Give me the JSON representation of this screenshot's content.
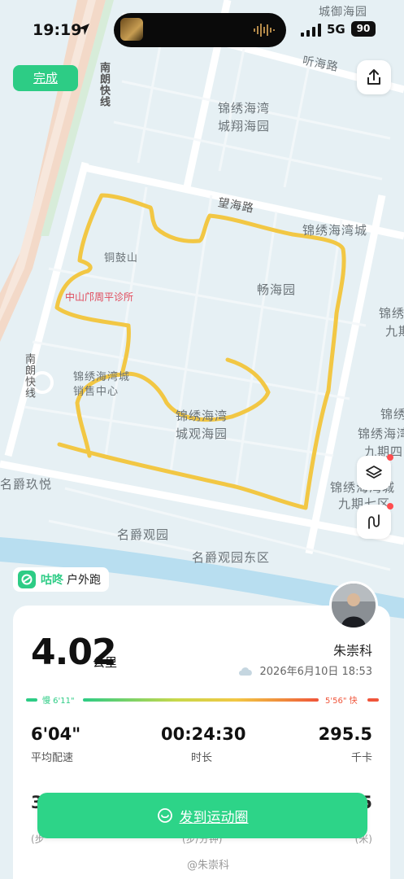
{
  "status_bar": {
    "time": "19:19",
    "network": "5G",
    "battery": "90"
  },
  "top": {
    "done_label": "完成"
  },
  "map": {
    "labels": {
      "chengdi": "城御海园",
      "tinghai_road": "听海路",
      "nanlang_fast": "南朗快线",
      "jinxiu_chengxiang": "锦绣海湾",
      "jinxiu_chengxiang2": "城翔海园",
      "wanghai_road": "望海路",
      "jinxiu_haiwancheng": "锦绣海湾城",
      "tonggushan": "铜鼓山",
      "clinic": "中山邝周平诊所",
      "changhaiyuan": "畅海园",
      "jinxiu_9_1": "锦绣",
      "jinxiu_9_2": "九期",
      "nanlang_fast2": "南朗快线",
      "sales_center_1": "锦绣海湾城",
      "sales_center_2": "销售中心",
      "jinxiu_right_1": "锦绣",
      "jinxiu_right_2": "锦绣海湾",
      "jinxiu_right_3": "九期四",
      "guanhaiyuan_1": "锦绣海湾",
      "guanhaiyuan_2": "城观海园",
      "mingjue_jiuyue": "名爵玖悦",
      "jinxiu_9q_1": "锦绣海湾城",
      "jinxiu_9q_2": "九期七区",
      "mingjue_guanyuan": "名爵观园",
      "mingjue_east": "名爵观园东区"
    },
    "route_color": "#f2c744"
  },
  "brand": {
    "name": "咕咚",
    "activity": "户外跑"
  },
  "card": {
    "distance": "4.02",
    "distance_unit": "公里",
    "username": "朱崇科",
    "datetime": "2026年6月10日 18:53",
    "pace_slow": "慢 6'11\"",
    "pace_fast": "5'56\" 快",
    "stats": [
      {
        "value": "6'04\"",
        "label": "平均配速"
      },
      {
        "value": "00:24:30",
        "label": "时长"
      },
      {
        "value": "295.5",
        "label": "千卡"
      }
    ],
    "row2_left": "3",
    "row2_right": "5",
    "row2_label_left": "(步",
    "row2_label_mid": "(步/分钟)",
    "row2_label_right": "(米)"
  },
  "share": {
    "label": "发到运动圈"
  },
  "watermark": "@朱崇科",
  "colors": {
    "accent": "#2dcc85"
  }
}
